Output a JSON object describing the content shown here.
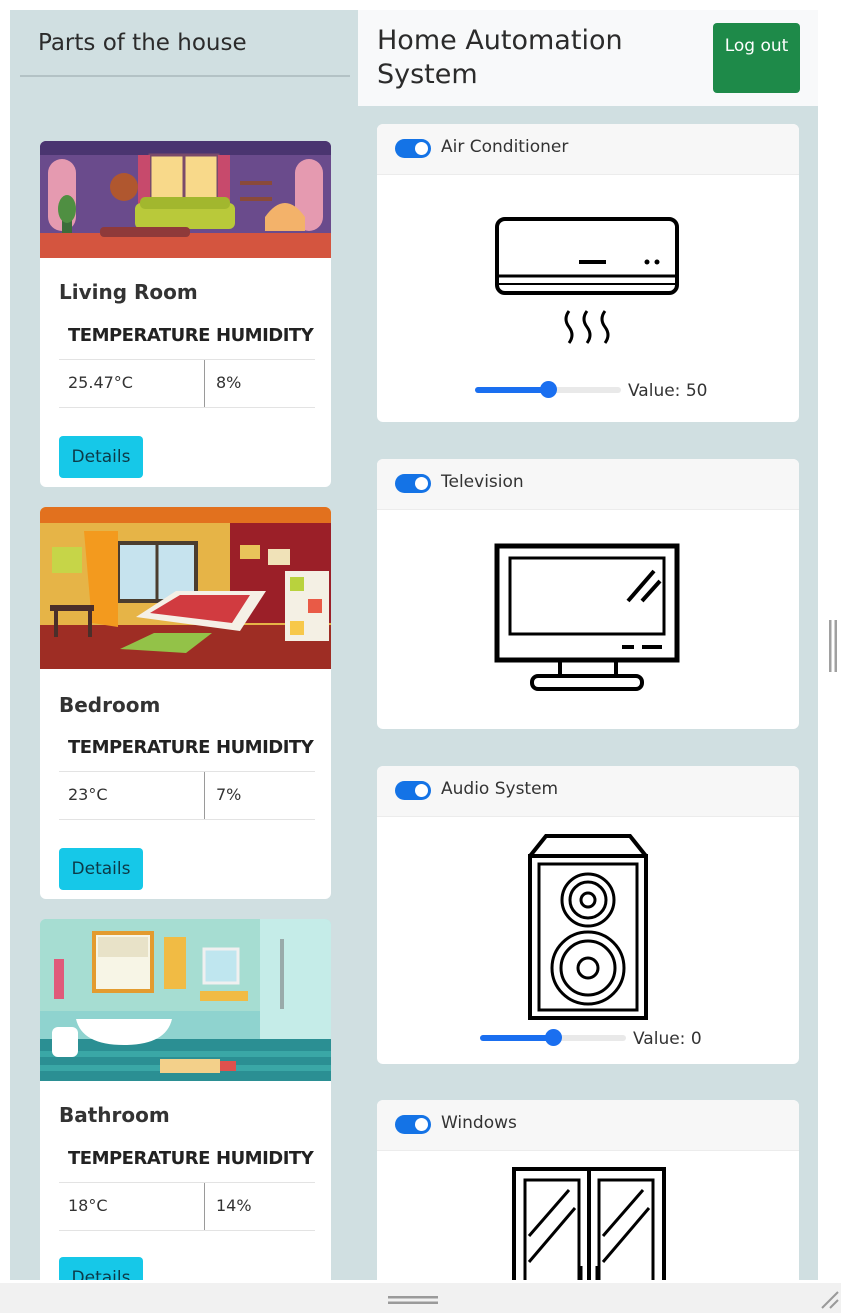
{
  "sidebar": {
    "title": "Parts of the house",
    "rooms": [
      {
        "name": "Living Room",
        "temperature_header": "TEMPERATURE",
        "humidity_header": "HUMIDITY",
        "temperature": "25.47°C",
        "humidity": "8%",
        "details_label": "Details"
      },
      {
        "name": "Bedroom",
        "temperature_header": "TEMPERATURE",
        "humidity_header": "HUMIDITY",
        "temperature": "23°C",
        "humidity": "7%",
        "details_label": "Details"
      },
      {
        "name": "Bathroom",
        "temperature_header": "TEMPERATURE",
        "humidity_header": "HUMIDITY",
        "temperature": "18°C",
        "humidity": "14%",
        "details_label": "Details"
      }
    ]
  },
  "header": {
    "title": "Home Automation System",
    "logout_label": "Log out"
  },
  "devices": [
    {
      "name": "Air Conditioner",
      "enabled": true,
      "icon": "air-conditioner-icon",
      "slider_level": 0.5,
      "value_text": "Value: 50"
    },
    {
      "name": "Television",
      "enabled": true,
      "icon": "television-icon"
    },
    {
      "name": "Audio System",
      "enabled": true,
      "icon": "speaker-icon",
      "slider_level": 0.5,
      "value_text": "Value: 0"
    },
    {
      "name": "Windows",
      "enabled": true,
      "icon": "window-icon"
    }
  ],
  "colors": {
    "page_background": "#d0dfe1",
    "details_button": "#16c8e8",
    "logout_button": "#1e8a49",
    "toggle_on": "#1473e6",
    "slider": "#1a6ff0"
  }
}
